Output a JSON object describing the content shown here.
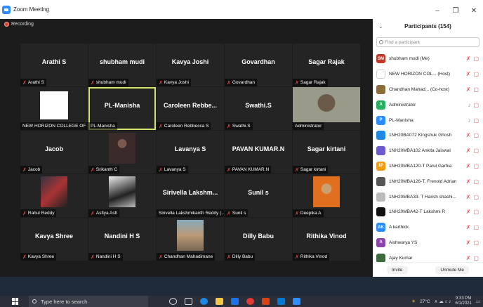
{
  "window": {
    "title": "Zoom Meeting",
    "minimize": "–",
    "restore": "❐",
    "close": "✕"
  },
  "meeting": {
    "recording": "Recording"
  },
  "tiles": [
    {
      "name": "Arathi S",
      "label": "Arathi S",
      "muted": true
    },
    {
      "name": "shubham mudi",
      "label": "shubham mudi",
      "muted": true
    },
    {
      "name": "Kavya Joshi",
      "label": "Kavya Joshi",
      "muted": true
    },
    {
      "name": "Govardhan",
      "label": "Govardhan",
      "muted": true
    },
    {
      "name": "Sagar Rajak",
      "label": "Sagar Rajak",
      "muted": true
    },
    {
      "name": "",
      "label": "NEW HORIZON COLLEGE OF ...",
      "muted": false,
      "image": "college-logo"
    },
    {
      "name": "PL-Manisha",
      "label": "PL-Manisha",
      "muted": false,
      "active": true
    },
    {
      "name": "Caroleen Rebbe...",
      "label": "Caroleen Rebbecca S",
      "muted": true
    },
    {
      "name": "Swathi.S",
      "label": "Swathi.S",
      "muted": true
    },
    {
      "name": "",
      "label": "Administrator",
      "muted": false,
      "image": "video-person"
    },
    {
      "name": "Jacob",
      "label": "Jacob",
      "muted": true
    },
    {
      "name": "",
      "label": "Srikanth C",
      "muted": true,
      "image": "profile-photo"
    },
    {
      "name": "Lavanya S",
      "label": "Lavanya S",
      "muted": true
    },
    {
      "name": "PAVAN KUMAR.N",
      "label": "PAVAN KUMAR.N",
      "muted": true
    },
    {
      "name": "Sagar kirtani",
      "label": "Sagar kirtani",
      "muted": true
    },
    {
      "name": "",
      "label": "Rahul Reddy",
      "muted": true,
      "image": "motorbike-photo"
    },
    {
      "name": "",
      "label": "Asfiya Asfi",
      "muted": true,
      "image": "art-photo"
    },
    {
      "name": "Sirivella Lakshm...",
      "label": "Sirivella Lakshmikanth Reddy (...",
      "muted": false
    },
    {
      "name": "Sunil s",
      "label": "Sunil s",
      "muted": true
    },
    {
      "name": "",
      "label": "Deepika A",
      "muted": true,
      "image": "profile-photo-2"
    },
    {
      "name": "Kavya Shree",
      "label": "Kavya Shree",
      "muted": true
    },
    {
      "name": "Nandini H S",
      "label": "Nandini H S",
      "muted": true
    },
    {
      "name": "",
      "label": "Chandhan Mahadimane",
      "muted": true,
      "image": "outdoor-photo"
    },
    {
      "name": "Dilly Babu",
      "label": "Dilly Babu",
      "muted": true
    },
    {
      "name": "Rithika Vinod",
      "label": "Rithika Vinod",
      "muted": true
    }
  ],
  "participants_panel": {
    "title": "Participants (154)",
    "search_placeholder": "Find a participant",
    "invite": "Invite",
    "unmute_me": "Unmute Me",
    "list": [
      {
        "initials": "SM",
        "color": "#c0392b",
        "name": "shubham mudi (Me)"
      },
      {
        "initials": "",
        "color": "#ffffff",
        "name": "NEW HORIZON COL... (Host)",
        "logo": true
      },
      {
        "initials": "",
        "color": "#8a6d3b",
        "name": "Chandhan Mahad... (Co-host)"
      },
      {
        "initials": "A",
        "color": "#27ae60",
        "name": "Administrator"
      },
      {
        "initials": "P",
        "color": "#2d8cff",
        "name": "PL-Manisha"
      },
      {
        "initials": "",
        "color": "#1e88e5",
        "name": "1NH20BA072 Kingshuk Ghosh"
      },
      {
        "initials": "",
        "color": "#6a5acd",
        "name": "1NH20MBA102 Ankita Jaiswal"
      },
      {
        "initials": "1P",
        "color": "#f39c12",
        "name": "1NH20MBA120-T Parul Garhia"
      },
      {
        "initials": "",
        "color": "#555555",
        "name": "1NH20MBA126-T, Frenold Adrian"
      },
      {
        "initials": "",
        "color": "#bbbbbb",
        "name": "1NH20MBA33-  T Harish shashi..."
      },
      {
        "initials": "",
        "color": "#111111",
        "name": "1NH20MBA42-T Lakshmi R"
      },
      {
        "initials": "AK",
        "color": "#2d8cff",
        "name": "A karthick"
      },
      {
        "initials": "A",
        "color": "#8e44ad",
        "name": "Aishwarya YS"
      },
      {
        "initials": "",
        "color": "#3d6b3d",
        "name": "Ajay Kumar"
      }
    ]
  },
  "taskbar": {
    "search_placeholder": "Type here to search",
    "weather": "27°C",
    "time": "9:33 PM",
    "date": "6/1/2021"
  }
}
